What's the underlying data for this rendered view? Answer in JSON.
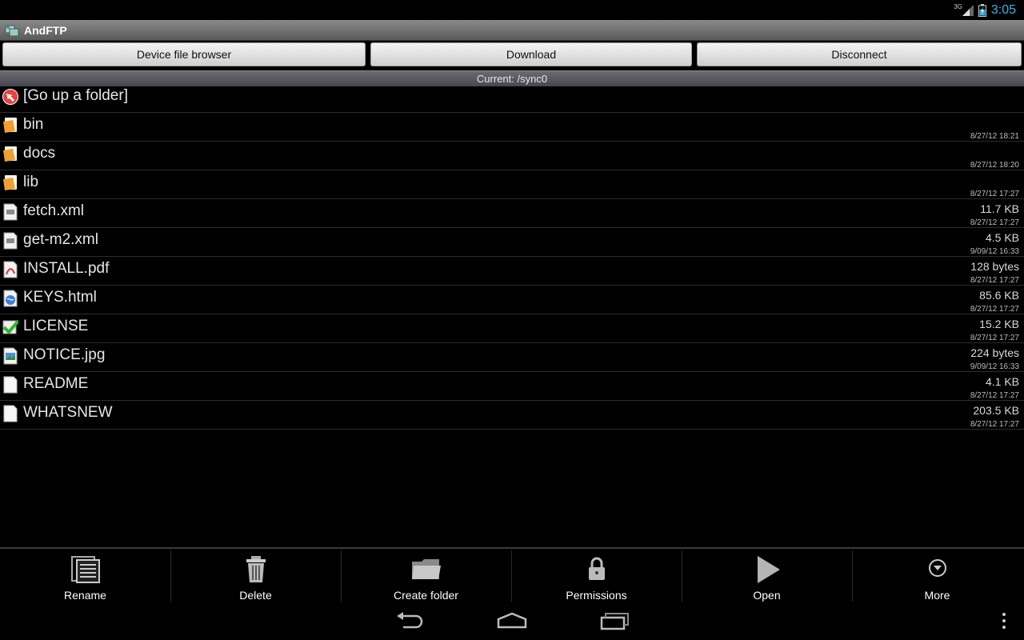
{
  "status": {
    "network": "3G",
    "time": "3:05"
  },
  "app": {
    "title": "AndFTP"
  },
  "top_buttons": {
    "device": "Device file browser",
    "download": "Download",
    "disconnect": "Disconnect"
  },
  "path": {
    "label": "Current: /sync0"
  },
  "files": [
    {
      "name": "[Go up a folder]",
      "type": "up",
      "size": "",
      "date": ""
    },
    {
      "name": "bin",
      "type": "folder",
      "size": "",
      "date": "8/27/12 18:21"
    },
    {
      "name": "docs",
      "type": "folder",
      "size": "",
      "date": "8/27/12 18:20"
    },
    {
      "name": "lib",
      "type": "folder",
      "size": "",
      "date": "8/27/12 17:27"
    },
    {
      "name": "fetch.xml",
      "type": "xml",
      "size": "11.7 KB",
      "date": "8/27/12 17:27"
    },
    {
      "name": "get-m2.xml",
      "type": "xml",
      "size": "4.5 KB",
      "date": "9/09/12 16:33"
    },
    {
      "name": "INSTALL.pdf",
      "type": "pdf",
      "size": "128 bytes",
      "date": "8/27/12 17:27"
    },
    {
      "name": "KEYS.html",
      "type": "html",
      "size": "85.6 KB",
      "date": "8/27/12 17:27"
    },
    {
      "name": "LICENSE",
      "type": "license",
      "size": "15.2 KB",
      "date": "8/27/12 17:27"
    },
    {
      "name": "NOTICE.jpg",
      "type": "image",
      "size": "224 bytes",
      "date": "9/09/12 16:33"
    },
    {
      "name": "README",
      "type": "text",
      "size": "4.1 KB",
      "date": "8/27/12 17:27"
    },
    {
      "name": "WHATSNEW",
      "type": "text",
      "size": "203.5 KB",
      "date": "8/27/12 17:27"
    }
  ],
  "actions": [
    {
      "label": "Rename",
      "icon": "rename-icon"
    },
    {
      "label": "Delete",
      "icon": "trash-icon"
    },
    {
      "label": "Create folder",
      "icon": "folder-icon"
    },
    {
      "label": "Permissions",
      "icon": "lock-icon"
    },
    {
      "label": "Open",
      "icon": "play-icon"
    },
    {
      "label": "More",
      "icon": "more-icon"
    }
  ],
  "colors": {
    "accent": "#33b5e5",
    "folder": "#f0a030",
    "background": "#000000"
  }
}
